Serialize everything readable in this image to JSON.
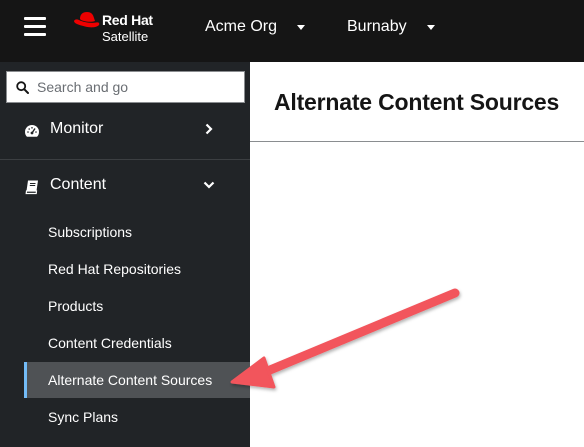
{
  "header": {
    "brand": {
      "name": "Red Hat",
      "product": "Satellite"
    },
    "organization": "Acme Org",
    "location": "Burnaby"
  },
  "sidebar": {
    "search": {
      "placeholder": "Search and go"
    },
    "groups": [
      {
        "label": "Monitor",
        "icon": "tachometer-icon",
        "expanded": false
      },
      {
        "label": "Content",
        "icon": "book-icon",
        "expanded": true
      }
    ],
    "content_items": [
      {
        "label": "Subscriptions"
      },
      {
        "label": "Red Hat Repositories"
      },
      {
        "label": "Products"
      },
      {
        "label": "Content Credentials"
      },
      {
        "label": "Alternate Content Sources",
        "active": true
      },
      {
        "label": "Sync Plans"
      }
    ]
  },
  "main": {
    "title": "Alternate Content Sources"
  },
  "colors": {
    "header_bg": "#151515",
    "sidebar_bg": "#212427",
    "active_item_bg": "#4f5255",
    "active_indicator": "#73bcf7",
    "brand_red": "#ee0000",
    "annotation_arrow": "#f2545b"
  }
}
